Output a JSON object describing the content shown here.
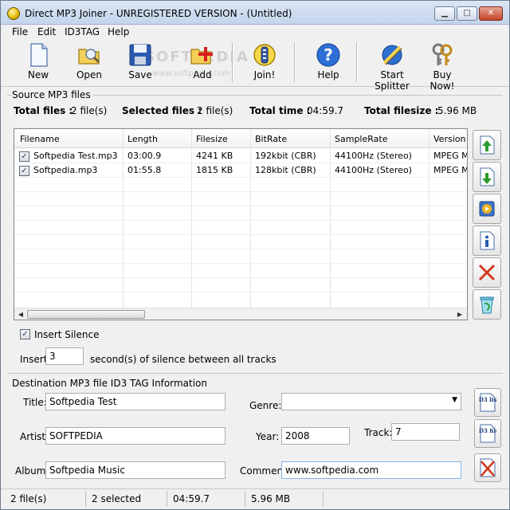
{
  "window": {
    "title": "Direct MP3 Joiner - UNREGISTERED VERSION - (Untitled)",
    "controls": {
      "minimize": "▁",
      "maximize": "□",
      "close": "✕"
    }
  },
  "menu": [
    "File",
    "Edit",
    "ID3TAG",
    "Help"
  ],
  "toolbar": {
    "new": "New",
    "open": "Open",
    "save": "Save",
    "add": "Add",
    "join": "Join!",
    "help": "Help",
    "start_splitter": "Start Splitter",
    "buy_now": "Buy Now!",
    "watermark": "SOFTPEDIA",
    "watermark_url": "www.softpedia.com"
  },
  "source": {
    "group_title": "Source MP3 files",
    "total_files_label": "Total files :",
    "total_files": "2 file(s)",
    "selected_files_label": "Selected files :",
    "selected_files": "2 file(s)",
    "total_time_label": "Total time :",
    "total_time": "04:59.7",
    "total_filesize_label": "Total filesize :",
    "total_filesize": "5.96 MB"
  },
  "files_table": {
    "columns": [
      "Filename",
      "Length",
      "Filesize",
      "BitRate",
      "SampleRate",
      "Version"
    ],
    "rows": [
      {
        "checked": true,
        "filename": "Softpedia Test.mp3",
        "length": "03:00.9",
        "filesize": "4241 KB",
        "bitrate": "192kbit (CBR)",
        "samplerate": "44100Hz (Stereo)",
        "version": "MPEG M"
      },
      {
        "checked": true,
        "filename": "Softpedia.mp3",
        "length": "01:55.8",
        "filesize": "1815 KB",
        "bitrate": "128kbit (CBR)",
        "samplerate": "44100Hz (Stereo)",
        "version": "MPEG M"
      }
    ]
  },
  "silence": {
    "checkbox_label": "Insert Silence",
    "checked": true,
    "insert_label": "Insert",
    "seconds": "3",
    "suffix": "second(s) of silence between all tracks"
  },
  "id3": {
    "group_title": "Destination MP3 file ID3 TAG Information",
    "title_label": "Title:",
    "title": "Softpedia Test",
    "genre_label": "Genre:",
    "genre": "",
    "artist_label": "Artist:",
    "artist": "SOFTPEDIA",
    "year_label": "Year:",
    "year": "2008",
    "track_label": "Track:",
    "track": "7",
    "album_label": "Album:",
    "album": "Softpedia Music",
    "comment_label": "Comment:",
    "comment": "www.softpedia.com",
    "list_btn": "ID3 list",
    "file_btn": "ID3 file"
  },
  "status": {
    "files": "2 file(s)",
    "selected": "2 selected",
    "time": "04:59.7",
    "size": "5.96 MB"
  },
  "colors": {
    "accent": "#1c3b7a",
    "remove_red": "#d23a1e",
    "arrow_green": "#2d9a2d"
  }
}
